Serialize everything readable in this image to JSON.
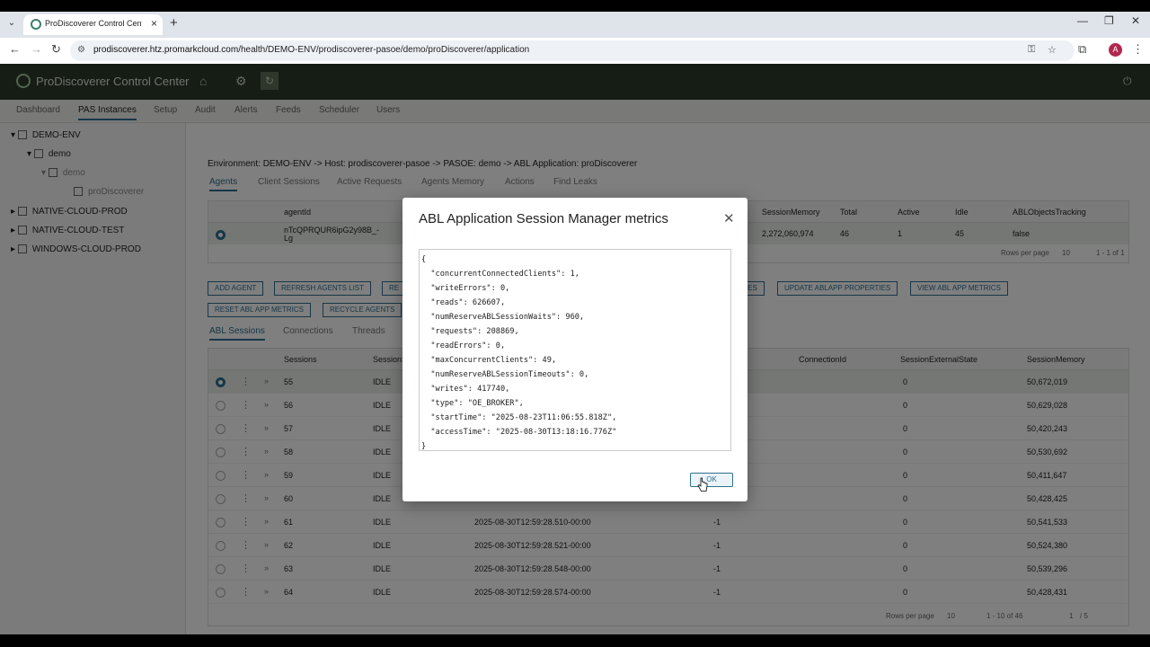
{
  "browser": {
    "tab_title": "ProDiscoverer Control Center -",
    "url_host": "prodiscoverer.htz.promarkcloud.com",
    "url_path": "/health/DEMO-ENV/prodiscoverer-pasoe/demo/proDiscoverer/application",
    "profile_initial": "A"
  },
  "app": {
    "title": "ProDiscoverer Control Center",
    "nav_tabs": [
      "Dashboard",
      "PAS Instances",
      "Setup",
      "Audit",
      "Alerts",
      "Feeds",
      "Scheduler",
      "Users"
    ],
    "tree": {
      "env1": "DEMO-ENV",
      "host1": "demo",
      "pasoe1": "demo",
      "app1": "proDiscoverer",
      "env2": "NATIVE-CLOUD-PROD",
      "env3": "NATIVE-CLOUD-TEST",
      "env4": "WINDOWS-CLOUD-PROD"
    },
    "breadcrumb": "Environment: DEMO-ENV -> Host: prodiscoverer-pasoe -> PASOE: demo -> ABL Application: proDiscoverer",
    "subtabs": [
      "Agents",
      "Client Sessions",
      "Active Requests",
      "Agents Memory",
      "Actions",
      "Find Leaks"
    ],
    "agents_grid": {
      "headers": [
        "agentId",
        "SessionMemory",
        "Total",
        "Active",
        "Idle",
        "ABLObjectsTracking"
      ],
      "row": [
        "nTcQPRQUR6ipG2y98B_-Lg",
        "2,272,060,974",
        "46",
        "1",
        "45",
        "false"
      ],
      "rows_per_page_label": "Rows per page",
      "rows_per_page": "10",
      "range": "1 - 1 of 1"
    },
    "buttons": [
      "ADD AGENT",
      "REFRESH AGENTS LIST",
      "RE",
      "TIES",
      "UPDATE ABLAPP PROPERTIES",
      "VIEW ABL APP METRICS",
      "RESET ABL APP METRICS",
      "RECYCLE AGENTS"
    ],
    "lower_tabs": [
      "ABL Sessions",
      "Connections",
      "Threads"
    ],
    "sessions_grid": {
      "headers": [
        "Sessions",
        "SessionS",
        "ConnectionId",
        "SessionExternalState",
        "SessionMemory"
      ],
      "rows": [
        [
          "55",
          "IDLE",
          "",
          "-1",
          "0",
          "50,672,019"
        ],
        [
          "56",
          "IDLE",
          "",
          "-1",
          "0",
          "50,629,028"
        ],
        [
          "57",
          "IDLE",
          "",
          "-1",
          "0",
          "50,420,243"
        ],
        [
          "58",
          "IDLE",
          "",
          "-1",
          "0",
          "50,530,692"
        ],
        [
          "59",
          "IDLE",
          "",
          "-1",
          "0",
          "50,411,647"
        ],
        [
          "60",
          "IDLE",
          "",
          "-1",
          "0",
          "50,428,425"
        ],
        [
          "61",
          "IDLE",
          "2025-08-30T12:59:28.510-00:00",
          "-1",
          "0",
          "50,541,533"
        ],
        [
          "62",
          "IDLE",
          "2025-08-30T12:59:28.521-00:00",
          "-1",
          "0",
          "50,524,380"
        ],
        [
          "63",
          "IDLE",
          "2025-08-30T12:59:28.548-00:00",
          "-1",
          "0",
          "50,539,296"
        ],
        [
          "64",
          "IDLE",
          "2025-08-30T12:59:28.574-00:00",
          "-1",
          "0",
          "50,428,431"
        ]
      ],
      "rows_per_page_label": "Rows per page",
      "rows_per_page": "10",
      "range": "1 - 10 of 46",
      "page": "1",
      "pages": "/ 5"
    }
  },
  "modal": {
    "title": "ABL Application Session Manager metrics",
    "json_lines": [
      "{",
      "  \"concurrentConnectedClients\": 1,",
      "  \"writeErrors\": 0,",
      "  \"reads\": 626607,",
      "  \"numReserveABLSessionWaits\": 960,",
      "  \"requests\": 208869,",
      "  \"readErrors\": 0,",
      "  \"maxConcurrentClients\": 49,",
      "  \"numReserveABLSessionTimeouts\": 0,",
      "  \"writes\": 417740,",
      "  \"type\": \"OE_BROKER\",",
      "  \"startTime\": \"2025-08-23T11:06:55.818Z\",",
      "  \"accessTime\": \"2025-08-30T13:18:16.776Z\"",
      "}"
    ],
    "ok_label": "OK"
  }
}
